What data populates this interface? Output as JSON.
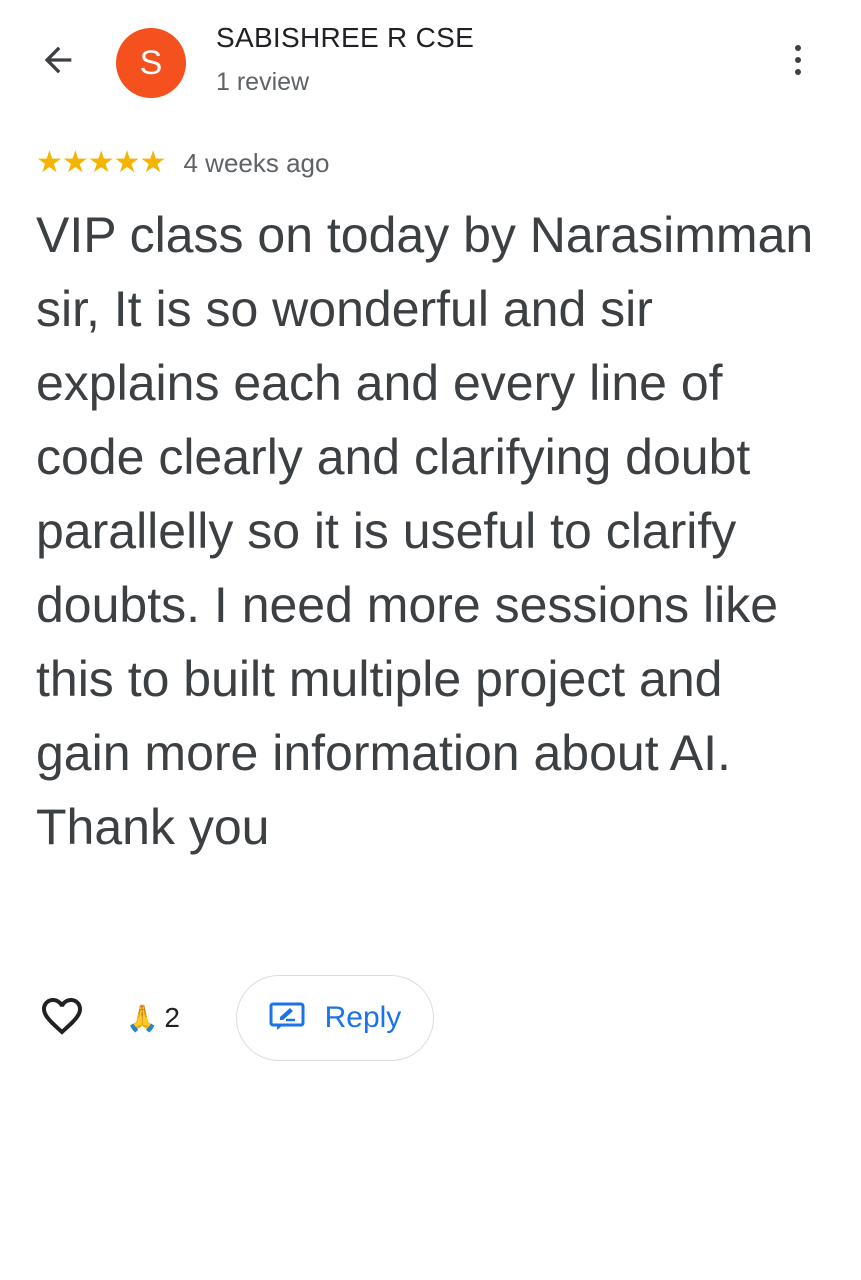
{
  "header": {
    "back_icon": "arrow-left-icon",
    "avatar_letter": "S",
    "avatar_color": "#f4511e",
    "author_name": "SABISHREE R CSE",
    "review_count": "1 review",
    "more_icon": "more-vert-icon"
  },
  "review": {
    "rating": 5,
    "rating_max": 5,
    "stars": "★★★★★",
    "star_color": "#f5b400",
    "date": "4 weeks ago",
    "text": "VIP class on today by Narasimman sir, It is so wonderful and sir explains each and every line of code clearly and clarifying doubt parallelly so it is useful to clarify doubts. I need more sessions like this to built multiple project and gain more information about AI. Thank you"
  },
  "actions": {
    "like_icon": "heart-outline-icon",
    "reaction_emoji": "🙏",
    "reaction_count": "2",
    "reply_icon": "reply-edit-icon",
    "reply_label": "Reply",
    "accent_color": "#1a73e8"
  }
}
